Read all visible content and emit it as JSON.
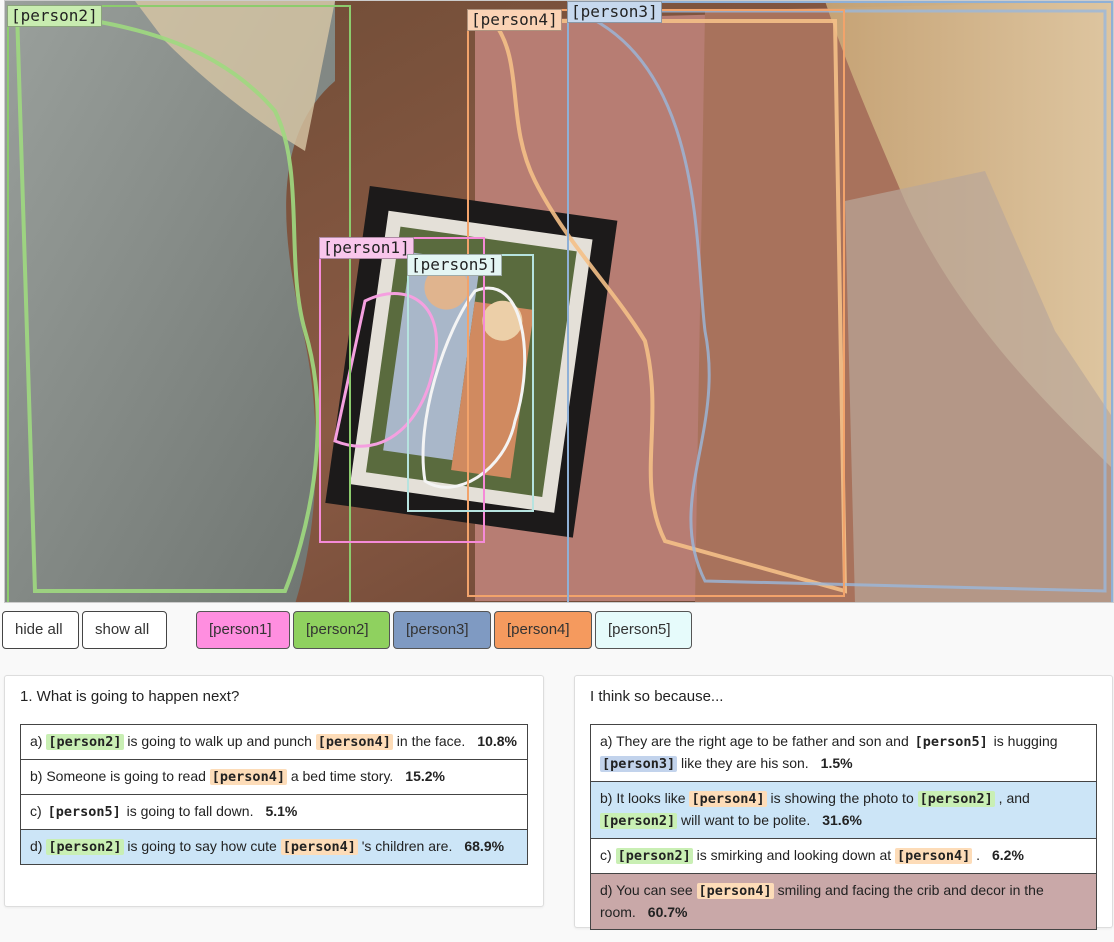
{
  "image": {
    "boxes": [
      {
        "label": "[person2]",
        "color": "#8ccc6d",
        "tag_bg": "#c8ecb0"
      },
      {
        "label": "[person4]",
        "color": "#f2a36b",
        "tag_bg": "#fbd3b5"
      },
      {
        "label": "[person3]",
        "color": "#8fb0d6",
        "tag_bg": "#c6d8ee"
      },
      {
        "label": "[person1]",
        "color": "#f58ad8",
        "tag_bg": "#f9c6ec"
      },
      {
        "label": "[person5]",
        "color": "#b6e3df",
        "tag_bg": "#e4f6f4"
      }
    ]
  },
  "controls": {
    "hide_all": "hide all",
    "show_all": "show all",
    "chips": [
      {
        "label": "[person1]",
        "color": "#ff8ee0"
      },
      {
        "label": "[person2]",
        "color": "#8fd15f"
      },
      {
        "label": "[person3]",
        "color": "#7f9ac2"
      },
      {
        "label": "[person4]",
        "color": "#f59a5e"
      },
      {
        "label": "[person5]",
        "color": "#e6fbfb"
      }
    ]
  },
  "question": {
    "title": "1. What is going to happen next?",
    "options": [
      {
        "letter": "a)",
        "parts": [
          [
            "t",
            " "
          ],
          [
            "p2",
            "[person2]"
          ],
          [
            "t",
            " is going to walk up and punch "
          ],
          [
            "p4",
            "[person4]"
          ],
          [
            "t",
            " in the face."
          ]
        ],
        "pct": "10.8%",
        "selected": false
      },
      {
        "letter": "b)",
        "parts": [
          [
            "t",
            " Someone is going to read "
          ],
          [
            "p4",
            "[person4]"
          ],
          [
            "t",
            " a bed time story."
          ]
        ],
        "pct": "15.2%",
        "selected": false
      },
      {
        "letter": "c)",
        "parts": [
          [
            "t",
            " "
          ],
          [
            "p5",
            "[person5]"
          ],
          [
            "t",
            " is going to fall down."
          ]
        ],
        "pct": "5.1%",
        "selected": false
      },
      {
        "letter": "d)",
        "parts": [
          [
            "t",
            " "
          ],
          [
            "p2",
            "[person2]"
          ],
          [
            "t",
            " is going to say how cute "
          ],
          [
            "p4",
            "[person4]"
          ],
          [
            "t",
            " 's children are."
          ]
        ],
        "pct": "68.9%",
        "selected": true
      }
    ]
  },
  "rationale": {
    "title": "I think so because...",
    "options": [
      {
        "letter": "a)",
        "parts": [
          [
            "t",
            " They are the right age to be father and son and "
          ],
          [
            "p5",
            "[person5]"
          ],
          [
            "t",
            " is hugging "
          ],
          [
            "p3",
            "[person3]"
          ],
          [
            "t",
            " like they are his son."
          ]
        ],
        "pct": "1.5%",
        "state": "none"
      },
      {
        "letter": "b)",
        "parts": [
          [
            "t",
            " It looks like "
          ],
          [
            "p4",
            "[person4]"
          ],
          [
            "t",
            " is showing the photo to "
          ],
          [
            "p2",
            "[person2]"
          ],
          [
            "t",
            " , and "
          ],
          [
            "p2",
            "[person2]"
          ],
          [
            "t",
            " will want to be polite."
          ]
        ],
        "pct": "31.6%",
        "state": "correct"
      },
      {
        "letter": "c)",
        "parts": [
          [
            "t",
            " "
          ],
          [
            "p2",
            "[person2]"
          ],
          [
            "t",
            " is smirking and looking down at "
          ],
          [
            "p4",
            "[person4]"
          ],
          [
            "t",
            " ."
          ]
        ],
        "pct": "6.2%",
        "state": "none"
      },
      {
        "letter": "d)",
        "parts": [
          [
            "t",
            " You can see "
          ],
          [
            "p4",
            "[person4]"
          ],
          [
            "t",
            " smiling and facing the crib and decor in the room."
          ]
        ],
        "pct": "60.7%",
        "state": "wrong"
      }
    ]
  },
  "colors": {
    "selected_bg": "#cce5f7",
    "wrong_bg": "#c9a8a8",
    "tag_p2": "#c9efb4",
    "tag_p3": "#c2d3ec",
    "tag_p4": "#fddcb8",
    "tag_p5": "#ffffff"
  }
}
